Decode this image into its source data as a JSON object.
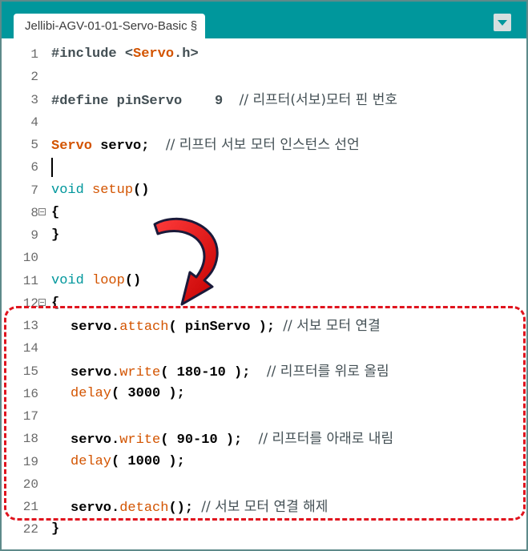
{
  "tab": {
    "title": "Jellibi-AGV-01-01-Servo-Basic §"
  },
  "colors": {
    "accent": "#00979c",
    "highlight": "#e0141e"
  },
  "icons": {
    "menu": "chevron-down-icon",
    "arrow": "curved-arrow-icon"
  },
  "lines": [
    {
      "n": "1",
      "t": [
        [
          "#include <",
          "pre"
        ],
        [
          "Servo",
          "class"
        ],
        [
          ".h>",
          "pre"
        ]
      ]
    },
    {
      "n": "2",
      "t": []
    },
    {
      "n": "3",
      "t": [
        [
          "#define pinServo    9  ",
          "pre"
        ],
        [
          "// 리프터(서보)모터 핀 번호",
          "comment"
        ]
      ]
    },
    {
      "n": "4",
      "t": []
    },
    {
      "n": "5",
      "t": [
        [
          "Servo",
          "class"
        ],
        [
          " servo;  ",
          ""
        ],
        [
          "// 리프터 서보 모터 인스턴스 선언",
          "comment"
        ]
      ]
    },
    {
      "n": "6",
      "t": []
    },
    {
      "n": "7",
      "t": [
        [
          "void",
          "type"
        ],
        [
          " ",
          ""
        ],
        [
          "setup",
          "fn"
        ],
        [
          "()",
          ""
        ]
      ]
    },
    {
      "n": "8",
      "t": [
        [
          "{",
          ""
        ]
      ],
      "fold": true
    },
    {
      "n": "9",
      "t": [
        [
          "}",
          ""
        ]
      ]
    },
    {
      "n": "10",
      "t": []
    },
    {
      "n": "11",
      "t": [
        [
          "void",
          "type"
        ],
        [
          " ",
          ""
        ],
        [
          "loop",
          "fn"
        ],
        [
          "()",
          ""
        ]
      ]
    },
    {
      "n": "12",
      "t": [
        [
          "{",
          ""
        ]
      ],
      "fold": true
    },
    {
      "n": "13",
      "t": [
        [
          "servo.",
          ""
        ],
        [
          "attach",
          "fn"
        ],
        [
          "( pinServo ); ",
          ""
        ],
        [
          "// 서보 모터 연결",
          "comment"
        ]
      ],
      "indent": true
    },
    {
      "n": "14",
      "t": []
    },
    {
      "n": "15",
      "t": [
        [
          "servo.",
          ""
        ],
        [
          "write",
          "fn"
        ],
        [
          "( 180-10 );  ",
          ""
        ],
        [
          "// 리프터를 위로 올림",
          "comment"
        ]
      ],
      "indent": true
    },
    {
      "n": "16",
      "t": [
        [
          "delay",
          "fn"
        ],
        [
          "( 3000 );",
          ""
        ]
      ],
      "indent": true
    },
    {
      "n": "17",
      "t": []
    },
    {
      "n": "18",
      "t": [
        [
          "servo.",
          ""
        ],
        [
          "write",
          "fn"
        ],
        [
          "( 90-10 );  ",
          ""
        ],
        [
          "// 리프터를 아래로 내림",
          "comment"
        ]
      ],
      "indent": true
    },
    {
      "n": "19",
      "t": [
        [
          "delay",
          "fn"
        ],
        [
          "( 1000 );",
          ""
        ]
      ],
      "indent": true
    },
    {
      "n": "20",
      "t": []
    },
    {
      "n": "21",
      "t": [
        [
          "servo.",
          ""
        ],
        [
          "detach",
          "fn"
        ],
        [
          "(); ",
          ""
        ],
        [
          "// 서보 모터 연결 해제",
          "comment"
        ]
      ],
      "indent": true
    },
    {
      "n": "22",
      "t": [
        [
          "}",
          ""
        ]
      ]
    }
  ]
}
